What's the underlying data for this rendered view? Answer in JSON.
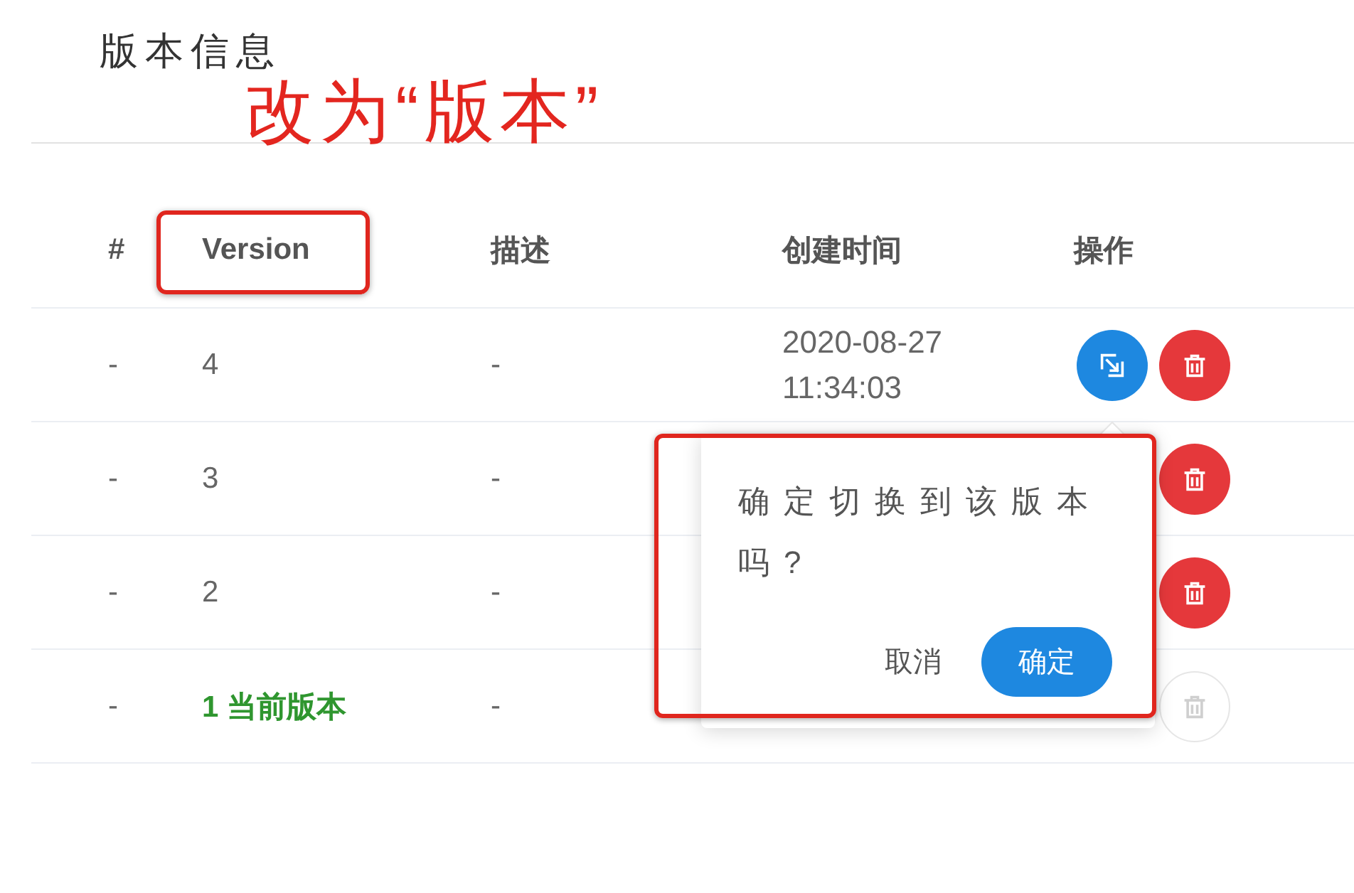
{
  "page": {
    "title": "版本信息"
  },
  "annotation": {
    "text": "改为“版本”"
  },
  "table": {
    "columns": [
      {
        "label": "#",
        "highlighted": false
      },
      {
        "label": "Version",
        "highlighted": true
      },
      {
        "label": "描述",
        "highlighted": false
      },
      {
        "label": "创建时间",
        "highlighted": false
      },
      {
        "label": "操作",
        "highlighted": false
      }
    ],
    "rows": [
      {
        "index": "-",
        "version": "4",
        "current": false,
        "description": "-",
        "created": "2020-08-27 11:34:03",
        "actions": [
          {
            "kind": "switch",
            "disabled": false
          },
          {
            "kind": "delete",
            "disabled": false
          }
        ]
      },
      {
        "index": "-",
        "version": "3",
        "current": false,
        "description": "-",
        "actions": [
          {
            "kind": "delete",
            "disabled": false
          }
        ]
      },
      {
        "index": "-",
        "version": "2",
        "current": false,
        "description": "-",
        "actions": [
          {
            "kind": "delete",
            "disabled": false
          }
        ]
      },
      {
        "index": "-",
        "version": "1 当前版本",
        "current": true,
        "description": "-",
        "actions": [
          {
            "kind": "delete",
            "disabled": true
          }
        ]
      }
    ]
  },
  "popover": {
    "message": "确定切换到该版本吗?",
    "highlighted": true,
    "buttons": [
      {
        "label": "取消",
        "kind": "text"
      },
      {
        "label": "确定",
        "kind": "primary"
      }
    ]
  }
}
